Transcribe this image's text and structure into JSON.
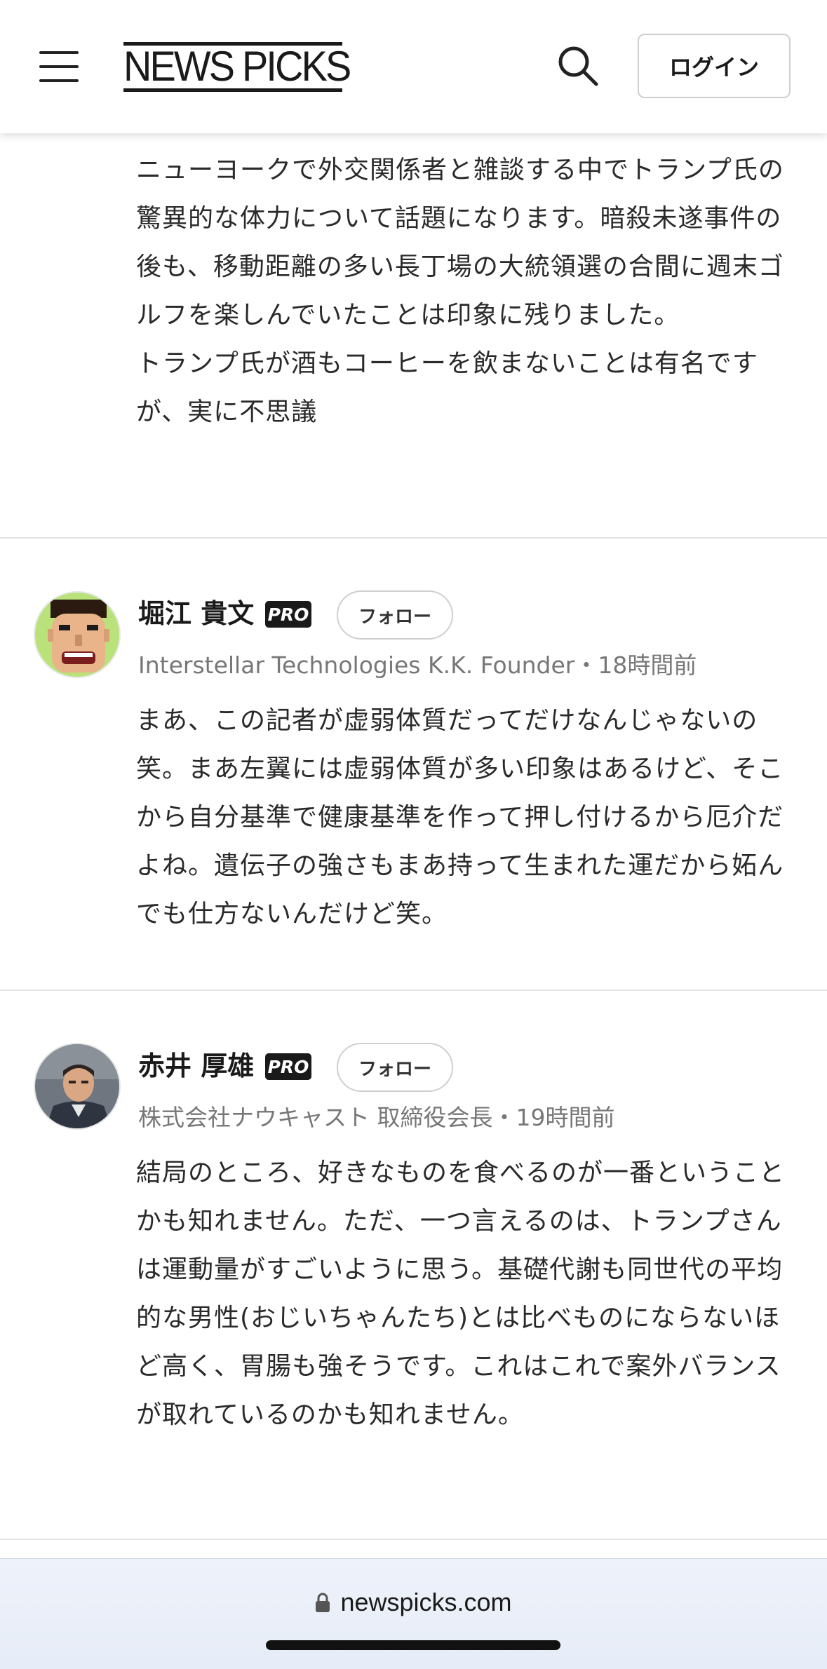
{
  "header": {
    "logo_text": "NEWS PICKS",
    "login_label": "ログイン"
  },
  "top_comment": {
    "paragraphs": [
      "ニューヨークで外交関係者と雑談する中でトランプ氏の驚異的な体力について話題になります。暗殺未遂事件の後も、移動距離の多い長丁場の大統領選の合間に週末ゴルフを楽しんでいたことは印象に残りました。",
      "トランプ氏が酒もコーヒーを飲まないことは有名ですが、実に不思議"
    ]
  },
  "comments": [
    {
      "name": "堀江 貴文",
      "badge": "PRO",
      "follow_label": "フォロー",
      "meta": "Interstellar Technologies K.K. Founder・18時間前",
      "body": "まあ、この記者が虚弱体質だってだけなんじゃないの笑。まあ左翼には虚弱体質が多い印象はあるけど、そこから自分基準で健康基準を作って押し付けるから厄介だよね。遺伝子の強さもまあ持って生まれた運だから妬んでも仕方ないんだけど笑。"
    },
    {
      "name": "赤井 厚雄",
      "badge": "PRO",
      "follow_label": "フォロー",
      "meta": "株式会社ナウキャスト 取締役会長・19時間前",
      "body": "結局のところ、好きなものを食べるのが一番ということかも知れません。ただ、一つ言えるのは、トランプさんは運動量がすごいように思う。基礎代謝も同世代の平均的な男性(おじいちゃんたち)とは比べものにならないほど高く、胃腸も強そうです。これはこれで案外バランスが取れているのかも知れません。"
    }
  ],
  "browser": {
    "url": "newspicks.com"
  }
}
